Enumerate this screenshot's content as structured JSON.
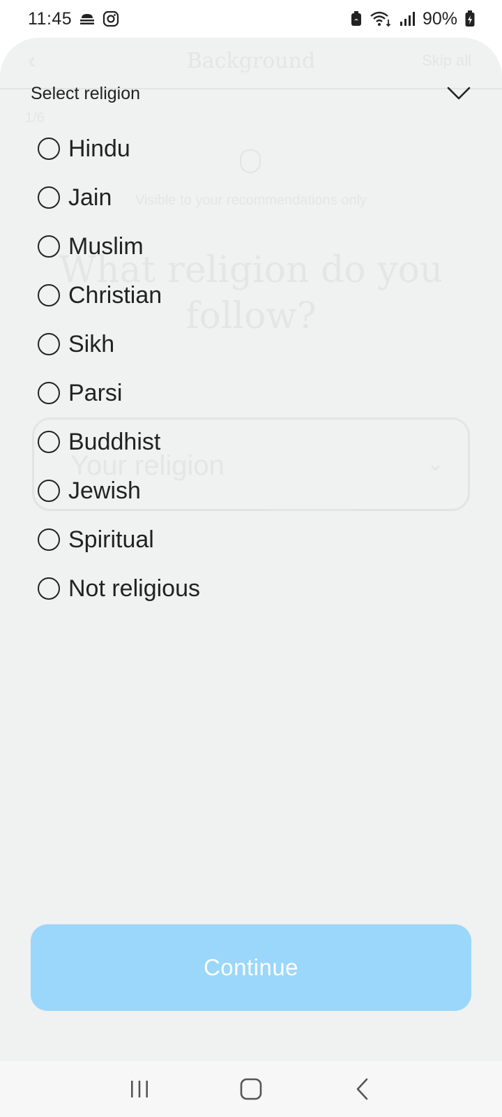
{
  "status_bar": {
    "time": "11:45",
    "battery": "90%",
    "left_icons": [
      "cloud-icon",
      "instagram-icon"
    ],
    "right_icons": [
      "battery-saver-icon",
      "wifi-icon",
      "signal-icon",
      "battery-icon"
    ]
  },
  "background": {
    "header_title": "Background",
    "skip_label": "Skip all",
    "step": "1/6",
    "visibility_note": "Visible to your recommendations only",
    "question": "What religion do you follow?",
    "field_placeholder": "Your religion"
  },
  "dropdown": {
    "title": "Select religion",
    "options": [
      {
        "label": "Hindu",
        "selected": false
      },
      {
        "label": "Jain",
        "selected": false
      },
      {
        "label": "Muslim",
        "selected": false
      },
      {
        "label": "Christian",
        "selected": false
      },
      {
        "label": "Sikh",
        "selected": false
      },
      {
        "label": "Parsi",
        "selected": false
      },
      {
        "label": "Buddhist",
        "selected": false
      },
      {
        "label": "Jewish",
        "selected": false
      },
      {
        "label": "Spiritual",
        "selected": false
      },
      {
        "label": "Not religious",
        "selected": false
      }
    ]
  },
  "continue_label": "Continue",
  "colors": {
    "accent_disabled": "#9ad7fb",
    "sheet_bg": "#f0f1f1"
  },
  "nav_bar": {
    "icons": [
      "recents-icon",
      "home-icon",
      "back-icon"
    ]
  }
}
